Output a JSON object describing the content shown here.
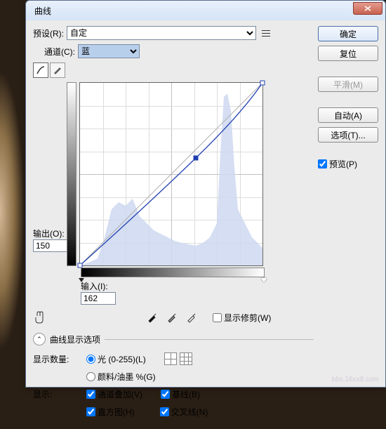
{
  "title": "曲线",
  "preset": {
    "label": "预设(R):",
    "value": "自定"
  },
  "channel": {
    "label": "通道(C):",
    "value": "蓝"
  },
  "buttons": {
    "ok": "确定",
    "reset": "复位",
    "smooth": "平滑(M)",
    "auto": "自动(A)",
    "options": "选项(T)..."
  },
  "preview": {
    "label": "预览(P)",
    "checked": true
  },
  "output": {
    "label": "输出(O):",
    "value": "150"
  },
  "input": {
    "label": "输入(I):",
    "value": "162"
  },
  "show_clip": {
    "label": "显示修剪(W)",
    "checked": false
  },
  "expand_header": "曲线显示选项",
  "display_amount": {
    "label": "显示数量:",
    "light": "光 (0-255)(L)",
    "pigment": "颜料/油墨 %(G)",
    "selected": "light"
  },
  "display": {
    "label": "显示:",
    "channel_overlay": {
      "label": "通道叠加(V)",
      "checked": true
    },
    "baseline": {
      "label": "基线(B)",
      "checked": true
    },
    "histogram": {
      "label": "直方图(H)",
      "checked": true
    },
    "intersection": {
      "label": "交叉线(N)",
      "checked": true
    }
  },
  "chart_data": {
    "type": "curve",
    "xlabel": "输入",
    "ylabel": "输出",
    "xlim": [
      0,
      255
    ],
    "ylim": [
      0,
      255
    ],
    "points": [
      {
        "x": 0,
        "y": 0
      },
      {
        "x": 162,
        "y": 150,
        "selected": true
      },
      {
        "x": 255,
        "y": 255
      }
    ],
    "baseline": [
      {
        "x": 0,
        "y": 0
      },
      {
        "x": 255,
        "y": 255
      }
    ],
    "histogram_peaks": [
      {
        "range": [
          0,
          30
        ],
        "height": 0.05
      },
      {
        "range": [
          30,
          80
        ],
        "height": 0.35
      },
      {
        "range": [
          80,
          140
        ],
        "height": 0.25
      },
      {
        "range": [
          140,
          200
        ],
        "height": 0.15
      },
      {
        "range": [
          200,
          230
        ],
        "height": 0.95
      },
      {
        "range": [
          230,
          255
        ],
        "height": 0.3
      }
    ]
  },
  "watermark": "bbs.16xx8.com"
}
